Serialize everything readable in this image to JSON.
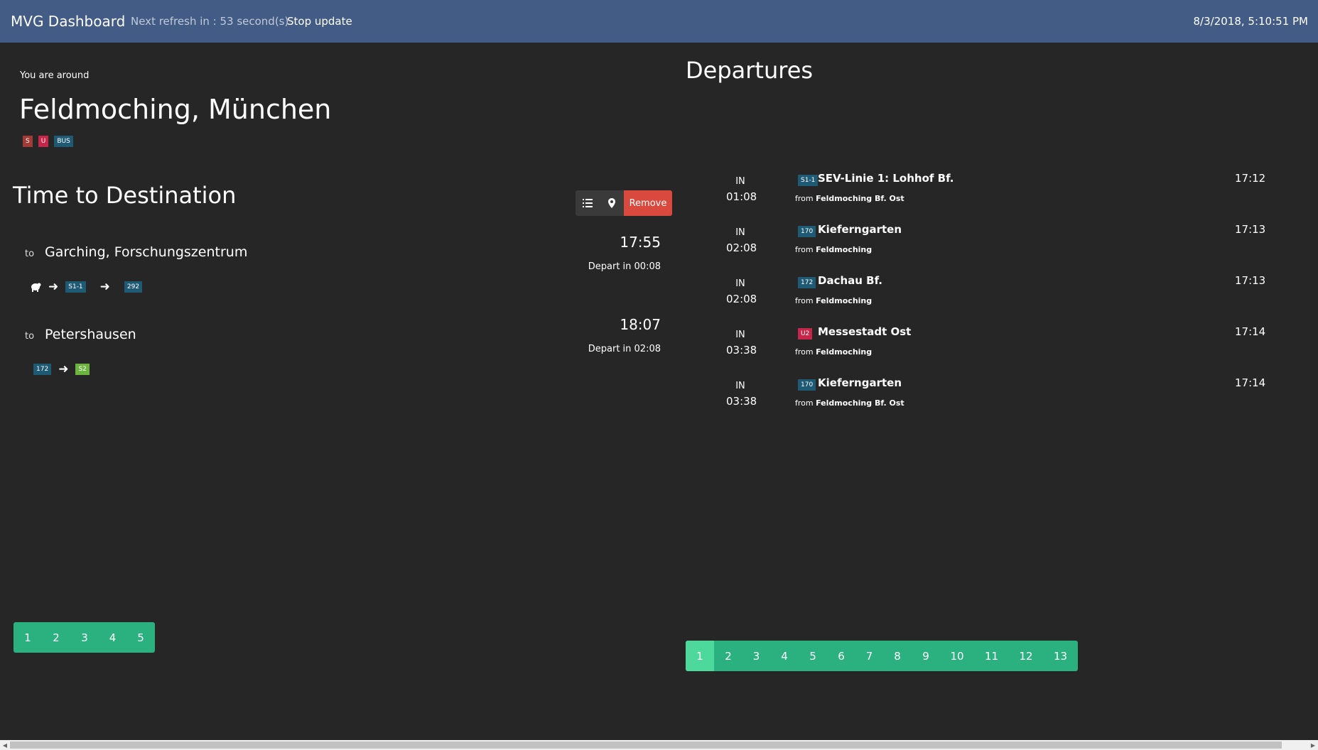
{
  "navbar": {
    "brand": "MVG Dashboard",
    "refresh_text": "Next refresh in : 53 second(s)",
    "stop_label": "Stop update",
    "datetime": "8/3/2018, 5:10:51 PM",
    "bg_color": "#425c86"
  },
  "location": {
    "label": "You are around",
    "name": "Feldmoching, München",
    "badges": [
      {
        "label": "S",
        "color": "#a23b35"
      },
      {
        "label": "U",
        "color": "#c5264a"
      },
      {
        "label": "BUS",
        "color": "#1f5a75"
      }
    ]
  },
  "time_to_destination": {
    "title": "Time to Destination",
    "toolbar": {
      "list_icon": "list-icon",
      "map_icon": "map-marker-icon",
      "remove_label": "Remove",
      "remove_color": "#d9493d"
    },
    "destinations": [
      {
        "to_label": "to",
        "name": "Garching, Forschungszentrum",
        "time": "17:55",
        "depart": "Depart in 00:08",
        "route": [
          {
            "type": "icon",
            "icon": "walking-icon"
          },
          {
            "type": "badge",
            "label": "S1-1",
            "color": "#1f5a75"
          },
          {
            "type": "badge",
            "label": "292",
            "color": "#1f5a75"
          }
        ]
      },
      {
        "to_label": "to",
        "name": "Petershausen",
        "time": "18:07",
        "depart": "Depart in 02:08",
        "route": [
          {
            "type": "badge",
            "label": "172",
            "color": "#1f5a75"
          },
          {
            "type": "badge",
            "label": "S2",
            "color": "#6db33f"
          }
        ]
      }
    ],
    "pages": [
      "1",
      "2",
      "3",
      "4",
      "5"
    ]
  },
  "departures": {
    "title": "Departures",
    "in_label": "IN",
    "from_label": "from",
    "rows": [
      {
        "eta": "01:08",
        "line": "S1-1",
        "line_color": "#1f5a75",
        "destination": "SEV-Linie 1: Lohhof Bf.",
        "from": "Feldmoching Bf. Ost",
        "time": "17:12"
      },
      {
        "eta": "02:08",
        "line": "170",
        "line_color": "#1f5a75",
        "destination": "Kieferngarten",
        "from": "Feldmoching",
        "time": "17:13"
      },
      {
        "eta": "02:08",
        "line": "172",
        "line_color": "#1f5a75",
        "destination": "Dachau Bf.",
        "from": "Feldmoching",
        "time": "17:13"
      },
      {
        "eta": "03:38",
        "line": "U2",
        "line_color": "#c5264a",
        "destination": "Messestadt Ost",
        "from": "Feldmoching",
        "time": "17:14"
      },
      {
        "eta": "03:38",
        "line": "170",
        "line_color": "#1f5a75",
        "destination": "Kieferngarten",
        "from": "Feldmoching Bf. Ost",
        "time": "17:14"
      }
    ],
    "pages": [
      "1",
      "2",
      "3",
      "4",
      "5",
      "6",
      "7",
      "8",
      "9",
      "10",
      "11",
      "12",
      "13"
    ],
    "active_page": "1"
  },
  "colors": {
    "background": "#262626",
    "pager": "#2bb07f",
    "pager_active": "#4dd89c"
  }
}
